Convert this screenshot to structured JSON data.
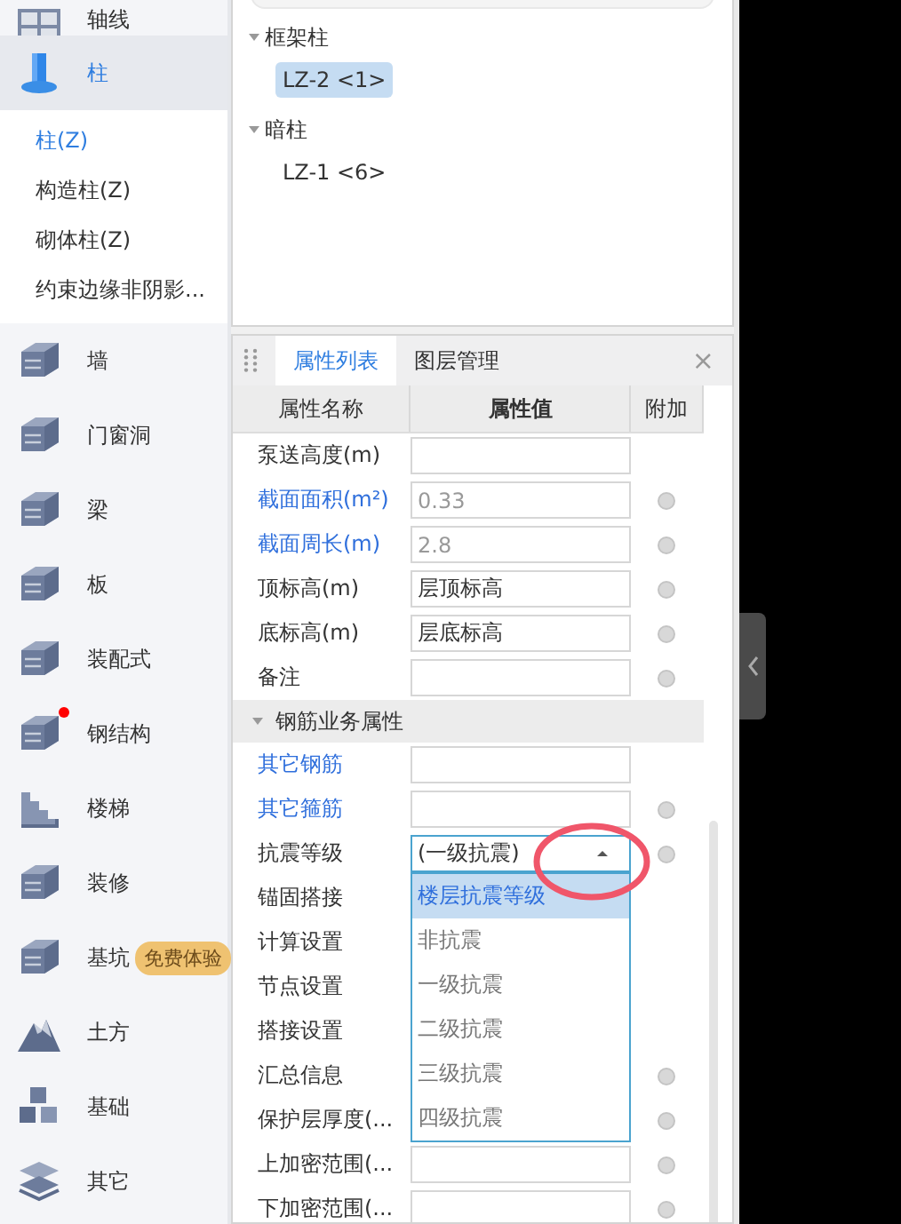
{
  "sidebar": {
    "items": [
      {
        "label": "轴线",
        "selected": false
      },
      {
        "label": "柱",
        "selected": true,
        "expanded": true,
        "children": [
          {
            "label": "柱(Z)",
            "selected": true
          },
          {
            "label": "构造柱(Z)",
            "selected": false
          },
          {
            "label": "砌体柱(Z)",
            "selected": false
          },
          {
            "label": "约束边缘非阴影...",
            "selected": false
          }
        ]
      },
      {
        "label": "墙",
        "selected": false
      },
      {
        "label": "门窗洞",
        "selected": false
      },
      {
        "label": "梁",
        "selected": false
      },
      {
        "label": "板",
        "selected": false
      },
      {
        "label": "装配式",
        "selected": false
      },
      {
        "label": "钢结构",
        "selected": false,
        "notify": true
      },
      {
        "label": "楼梯",
        "selected": false
      },
      {
        "label": "装修",
        "selected": false
      },
      {
        "label": "基坑",
        "selected": false,
        "badge": "免费体验"
      },
      {
        "label": "土方",
        "selected": false
      },
      {
        "label": "基础",
        "selected": false
      },
      {
        "label": "其它",
        "selected": false
      }
    ]
  },
  "component_tree": [
    {
      "label": "框架柱",
      "expanded": true,
      "children": [
        {
          "label": "LZ-2 <1>",
          "selected": true
        }
      ]
    },
    {
      "label": "暗柱",
      "expanded": true,
      "children": [
        {
          "label": "LZ-1 <6>",
          "selected": false
        }
      ]
    }
  ],
  "properties_panel": {
    "tabs": [
      {
        "label": "属性列表",
        "selected": true
      },
      {
        "label": "图层管理",
        "selected": false
      }
    ],
    "close": "×",
    "columns": [
      "属性名称",
      "属性值",
      "附加"
    ],
    "rows": [
      {
        "kind": "field",
        "label": "泵送高度(m)",
        "linked": false,
        "attach": false
      },
      {
        "kind": "field",
        "label": "截面面积(m²)",
        "value": "0.33",
        "linked": true,
        "readonly": true,
        "attach": true
      },
      {
        "kind": "field",
        "label": "截面周长(m)",
        "value": "2.8",
        "linked": true,
        "readonly": true,
        "attach": true
      },
      {
        "kind": "field",
        "label": "顶标高(m)",
        "value": "层顶标高",
        "linked": false,
        "readonly": false,
        "attach": true
      },
      {
        "kind": "field",
        "label": "底标高(m)",
        "value": "层底标高",
        "linked": false,
        "readonly": false,
        "attach": true
      },
      {
        "kind": "field",
        "label": "备注",
        "linked": false,
        "attach": true
      },
      {
        "kind": "group",
        "label": "钢筋业务属性",
        "expanded": true
      },
      {
        "kind": "field",
        "label": "其它钢筋",
        "linked": true,
        "attach": false
      },
      {
        "kind": "field",
        "label": "其它箍筋",
        "linked": true,
        "attach": true
      },
      {
        "kind": "dropdown",
        "label": "抗震等级",
        "value": "(一级抗震)",
        "linked": false,
        "attach": true,
        "open": true,
        "options": [
          {
            "label": "楼层抗震等级",
            "selected": true
          },
          {
            "label": "非抗震",
            "selected": false
          },
          {
            "label": "一级抗震",
            "selected": false
          },
          {
            "label": "二级抗震",
            "selected": false
          },
          {
            "label": "三级抗震",
            "selected": false
          },
          {
            "label": "四级抗震",
            "selected": false
          }
        ]
      },
      {
        "kind": "plain",
        "label": "锚固搭接",
        "linked": false,
        "attach": false
      },
      {
        "kind": "plain",
        "label": "计算设置",
        "linked": false,
        "attach": false
      },
      {
        "kind": "plain",
        "label": "节点设置",
        "linked": false,
        "attach": false
      },
      {
        "kind": "plain",
        "label": "搭接设置",
        "linked": false,
        "attach": false
      },
      {
        "kind": "plain",
        "label": "汇总信息",
        "linked": false,
        "attach": true
      },
      {
        "kind": "plain",
        "label": "保护层厚度(...",
        "linked": false,
        "attach": true
      },
      {
        "kind": "field",
        "label": "上加密范围(...",
        "linked": false,
        "attach": true
      },
      {
        "kind": "field",
        "label": "下加密范围(...",
        "linked": false,
        "attach": true
      }
    ]
  }
}
